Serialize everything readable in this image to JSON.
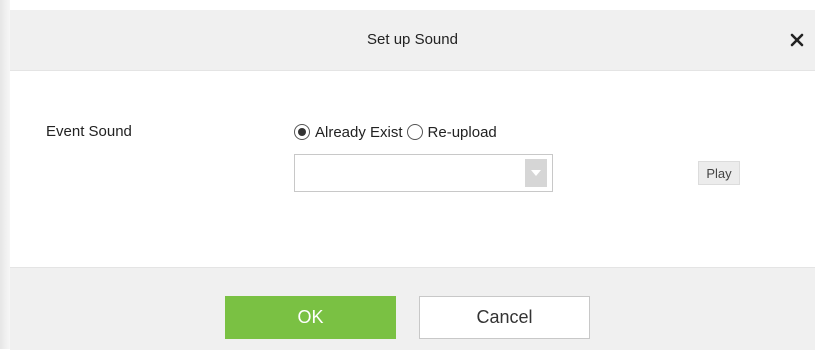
{
  "dialog": {
    "title": "Set up Sound",
    "close_icon": "close-icon"
  },
  "form": {
    "event_sound_label": "Event Sound",
    "options": [
      {
        "label": "Already Exist",
        "selected": true
      },
      {
        "label": "Re-upload",
        "selected": false
      }
    ],
    "sound_select": {
      "value": "",
      "arrow_icon": "chevron-down-icon"
    },
    "play_label": "Play"
  },
  "footer": {
    "ok_label": "OK",
    "cancel_label": "Cancel"
  },
  "colors": {
    "accent": "#7ac143",
    "title_bar": "#f0f0f0",
    "footer": "#f0f0f0"
  }
}
